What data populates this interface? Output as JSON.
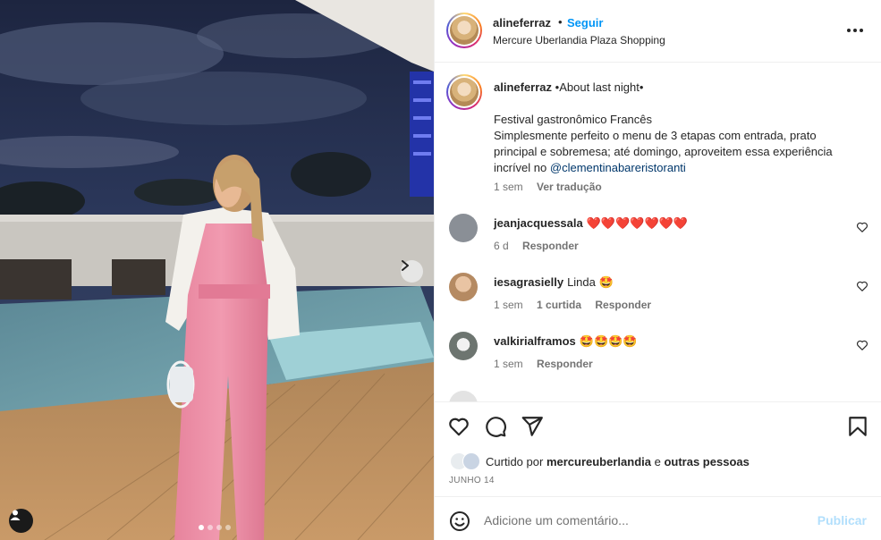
{
  "post": {
    "username": "alineferraz",
    "separator": "•",
    "follow_label": "Seguir",
    "location": "Mercure Uberlandia Plaza Shopping",
    "more_icon": "more-horizontal-icon"
  },
  "caption": {
    "username": "alineferraz",
    "title": "•About last night•",
    "line1": "Festival gastronômico Francês",
    "line2": "Simplesmente perfeito o menu de 3 etapas com entrada, prato principal e sobremesa; até domingo, aproveitem essa experiência incrível no",
    "mention": "@clementinabareristoranti",
    "time": "1 sem",
    "translate_label": "Ver tradução"
  },
  "comments": [
    {
      "username": "jeanjacquessala",
      "text": "❤️❤️❤️❤️❤️❤️❤️",
      "time": "6 d",
      "likes": "",
      "reply_label": "Responder",
      "avatar_color": "#8a8f96"
    },
    {
      "username": "iesagrasielly",
      "text": "Linda 🤩",
      "time": "1 sem",
      "likes": "1 curtida",
      "reply_label": "Responder",
      "avatar_color": "#b58a62"
    },
    {
      "username": "valkirialframos",
      "text": "🤩🤩🤩🤩",
      "time": "1 sem",
      "likes": "",
      "reply_label": "Responder",
      "avatar_color": "#6d7570"
    }
  ],
  "actions": {
    "like_icon": "heart-icon",
    "comment_icon": "comment-icon",
    "share_icon": "send-icon",
    "save_icon": "bookmark-icon",
    "liked_by_prefix": "Curtido por",
    "liked_by_user": "mercureuberlandia",
    "liked_by_and": "e",
    "liked_by_others": "outras pessoas",
    "date": "JUNHO 14"
  },
  "add_comment": {
    "placeholder": "Adicione um comentário...",
    "publish_label": "Publicar",
    "emoji_icon": "smiley-icon"
  },
  "carousel": {
    "total_slides": 4,
    "active_slide": 1,
    "next_icon": "chevron-right-icon",
    "user_tag_icon": "user-tag-icon"
  },
  "colors": {
    "accent": "#0095f6",
    "mention": "#00376b",
    "muted": "#737373",
    "publish_disabled": "#b2dffc",
    "heart": "#ed4956"
  }
}
